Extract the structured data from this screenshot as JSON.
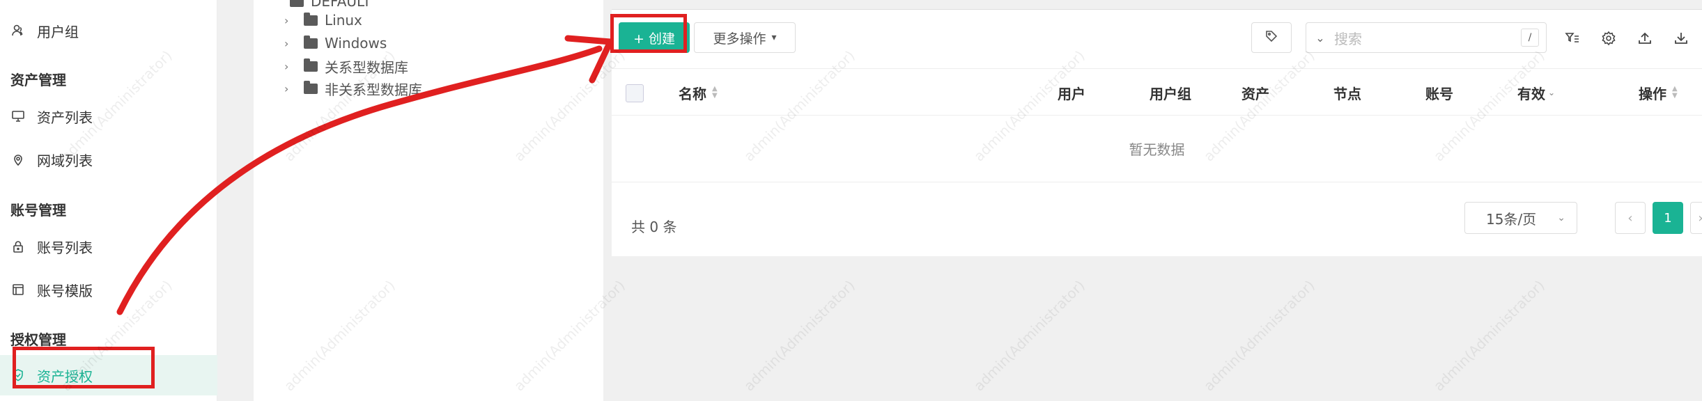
{
  "sidebar": {
    "user_group": "用户组",
    "group_asset_mgmt": "资产管理",
    "asset_list": "资产列表",
    "domain_list": "网域列表",
    "group_account_mgmt": "账号管理",
    "account_list": "账号列表",
    "account_template": "账号模版",
    "group_perm_mgmt": "授权管理",
    "asset_permission": "资产授权"
  },
  "tree": {
    "root": "DEFAULT",
    "nodes": [
      "Linux",
      "Windows",
      "关系型数据库",
      "非关系型数据库"
    ]
  },
  "toolbar": {
    "create_label": "+ 创建",
    "more_label": "更多操作",
    "search_placeholder": "搜索",
    "search_shortcut": "/"
  },
  "table": {
    "columns": [
      "名称",
      "用户",
      "用户组",
      "资产",
      "节点",
      "账号",
      "有效",
      "操作"
    ],
    "empty_text": "暂无数据"
  },
  "pagination": {
    "total_text": "共 0 条",
    "page_size": "15条/页",
    "current_page": "1"
  },
  "watermark": "admin(Administrator)",
  "colors": {
    "accent": "#1ab394",
    "annotation": "#e02020"
  }
}
